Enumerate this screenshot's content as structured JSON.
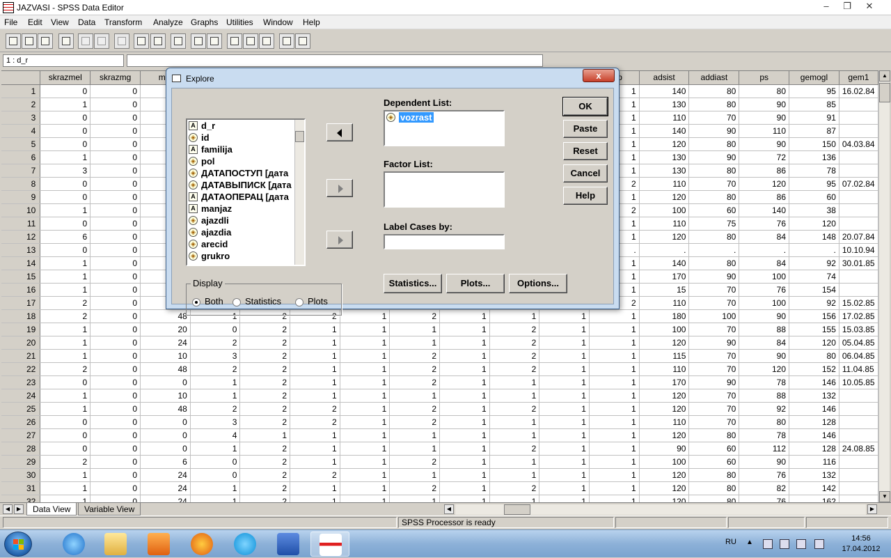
{
  "window": {
    "title": "JAZVASI - SPSS Data Editor"
  },
  "menu": [
    "File",
    "Edit",
    "View",
    "Data",
    "Transform",
    "Analyze",
    "Graphs",
    "Utilities",
    "Window",
    "Help"
  ],
  "cellbar": {
    "ref": "1 : d_r",
    "value": ""
  },
  "grid": {
    "columns": [
      "skrazmel",
      "skrazmg",
      "mel",
      "",
      "",
      "",
      "",
      "",
      "",
      "",
      "",
      "emp",
      "adsist",
      "addiast",
      "ps",
      "gemogl",
      "gem1"
    ],
    "rows": [
      [
        "1",
        "0",
        "0",
        "",
        "",
        "",
        "",
        "",
        "",
        "",
        "",
        "",
        "1",
        "140",
        "80",
        "80",
        "95",
        "16.02.84"
      ],
      [
        "2",
        "1",
        "0",
        "",
        "",
        "",
        "",
        "",
        "",
        "",
        "",
        "",
        "1",
        "130",
        "80",
        "90",
        "85",
        ""
      ],
      [
        "3",
        "0",
        "0",
        "",
        "",
        "",
        "",
        "",
        "",
        "",
        "",
        "",
        "1",
        "110",
        "70",
        "90",
        "91",
        ""
      ],
      [
        "4",
        "0",
        "0",
        "",
        "",
        "",
        "",
        "",
        "",
        "",
        "",
        "",
        "1",
        "140",
        "90",
        "110",
        "87",
        ""
      ],
      [
        "5",
        "0",
        "0",
        "",
        "",
        "",
        "",
        "",
        "",
        "",
        "",
        "",
        "1",
        "120",
        "80",
        "90",
        "150",
        "04.03.84"
      ],
      [
        "6",
        "1",
        "0",
        "",
        "",
        "",
        "",
        "",
        "",
        "",
        "",
        "",
        "1",
        "130",
        "90",
        "72",
        "136",
        ""
      ],
      [
        "7",
        "3",
        "0",
        "",
        "",
        "",
        "",
        "",
        "",
        "",
        "",
        "",
        "1",
        "130",
        "80",
        "86",
        "78",
        ""
      ],
      [
        "8",
        "0",
        "0",
        "",
        "",
        "",
        "",
        "",
        "",
        "",
        "",
        "",
        "2",
        "110",
        "70",
        "120",
        "95",
        "07.02.84"
      ],
      [
        "9",
        "0",
        "0",
        "",
        "",
        "",
        "",
        "",
        "",
        "",
        "",
        "",
        "1",
        "120",
        "80",
        "86",
        "60",
        ""
      ],
      [
        "10",
        "1",
        "0",
        "",
        "",
        "",
        "",
        "",
        "",
        "",
        "",
        "",
        "2",
        "100",
        "60",
        "140",
        "38",
        ""
      ],
      [
        "11",
        "0",
        "0",
        "",
        "",
        "",
        "",
        "",
        "",
        "",
        "",
        "",
        "1",
        "110",
        "75",
        "76",
        "120",
        ""
      ],
      [
        "12",
        "6",
        "0",
        "",
        "",
        "",
        "",
        "",
        "",
        "",
        "",
        "",
        "1",
        "120",
        "80",
        "84",
        "148",
        "20.07.84"
      ],
      [
        "13",
        "0",
        "0",
        "",
        "",
        "",
        "",
        "",
        "",
        "",
        "",
        "",
        ".",
        ".",
        ".",
        ".",
        ".",
        "10.10.94"
      ],
      [
        "14",
        "1",
        "0",
        "",
        "",
        "",
        "",
        "",
        "",
        "",
        "",
        "",
        "1",
        "140",
        "80",
        "84",
        "92",
        "30.01.85"
      ],
      [
        "15",
        "1",
        "0",
        "",
        "",
        "",
        "",
        "",
        "",
        "",
        "",
        "",
        "1",
        "170",
        "90",
        "100",
        "74",
        ""
      ],
      [
        "16",
        "1",
        "0",
        "",
        "",
        "",
        "",
        "",
        "",
        "",
        "",
        "",
        "1",
        "15",
        "70",
        "76",
        "154",
        ""
      ],
      [
        "17",
        "2",
        "0",
        "",
        "",
        "",
        "",
        "",
        "",
        "",
        "",
        "",
        "2",
        "110",
        "70",
        "100",
        "92",
        "15.02.85"
      ],
      [
        "18",
        "2",
        "0",
        "48",
        "1",
        "2",
        "2",
        "1",
        "2",
        "1",
        "1",
        "1",
        "1",
        "180",
        "100",
        "90",
        "156",
        "17.02.85"
      ],
      [
        "19",
        "1",
        "0",
        "20",
        "0",
        "2",
        "1",
        "1",
        "1",
        "1",
        "2",
        "1",
        "1",
        "100",
        "70",
        "88",
        "155",
        "15.03.85"
      ],
      [
        "20",
        "1",
        "0",
        "24",
        "2",
        "2",
        "1",
        "1",
        "1",
        "1",
        "2",
        "1",
        "1",
        "120",
        "90",
        "84",
        "120",
        "05.04.85"
      ],
      [
        "21",
        "1",
        "0",
        "10",
        "3",
        "2",
        "1",
        "1",
        "2",
        "1",
        "2",
        "1",
        "1",
        "115",
        "70",
        "90",
        "80",
        "06.04.85"
      ],
      [
        "22",
        "2",
        "0",
        "48",
        "2",
        "2",
        "1",
        "1",
        "2",
        "1",
        "2",
        "1",
        "1",
        "110",
        "70",
        "120",
        "152",
        "11.04.85"
      ],
      [
        "23",
        "0",
        "0",
        "0",
        "1",
        "2",
        "1",
        "1",
        "2",
        "1",
        "1",
        "1",
        "1",
        "170",
        "90",
        "78",
        "146",
        "10.05.85"
      ],
      [
        "24",
        "1",
        "0",
        "10",
        "1",
        "2",
        "1",
        "1",
        "1",
        "1",
        "1",
        "1",
        "1",
        "120",
        "70",
        "88",
        "132",
        ""
      ],
      [
        "25",
        "1",
        "0",
        "48",
        "2",
        "2",
        "2",
        "1",
        "2",
        "1",
        "2",
        "1",
        "1",
        "120",
        "70",
        "92",
        "146",
        ""
      ],
      [
        "26",
        "0",
        "0",
        "0",
        "3",
        "2",
        "2",
        "1",
        "2",
        "1",
        "1",
        "1",
        "1",
        "110",
        "70",
        "80",
        "128",
        ""
      ],
      [
        "27",
        "0",
        "0",
        "0",
        "4",
        "1",
        "1",
        "1",
        "1",
        "1",
        "1",
        "1",
        "1",
        "120",
        "80",
        "78",
        "146",
        ""
      ],
      [
        "28",
        "0",
        "0",
        "0",
        "1",
        "2",
        "1",
        "1",
        "1",
        "1",
        "2",
        "1",
        "1",
        "90",
        "60",
        "112",
        "128",
        "24.08.85"
      ],
      [
        "29",
        "2",
        "0",
        "6",
        "0",
        "2",
        "1",
        "1",
        "2",
        "1",
        "1",
        "1",
        "1",
        "100",
        "60",
        "90",
        "116",
        ""
      ],
      [
        "30",
        "1",
        "0",
        "24",
        "0",
        "2",
        "2",
        "1",
        "1",
        "1",
        "1",
        "1",
        "1",
        "120",
        "80",
        "76",
        "132",
        ""
      ],
      [
        "31",
        "1",
        "0",
        "24",
        "1",
        "2",
        "1",
        "1",
        "2",
        "1",
        "2",
        "1",
        "1",
        "120",
        "80",
        "82",
        "142",
        ""
      ],
      [
        "32",
        "1",
        "0",
        "24",
        "1",
        "2",
        "1",
        "1",
        "1",
        "1",
        "1",
        "1",
        "1",
        "120",
        "80",
        "76",
        "162",
        ""
      ]
    ]
  },
  "tabs": {
    "data_view": "Data View",
    "variable_view": "Variable View"
  },
  "status": {
    "processor": "SPSS Processor  is ready"
  },
  "dialog": {
    "title": "Explore",
    "variables": [
      {
        "name": "d_r",
        "type": "string"
      },
      {
        "name": "id",
        "type": "numeric"
      },
      {
        "name": "familija",
        "type": "string"
      },
      {
        "name": "pol",
        "type": "numeric"
      },
      {
        "name": "ДАТАПОСТУП [дата",
        "type": "numeric"
      },
      {
        "name": "ДАТАВЫПИСК [дата",
        "type": "numeric"
      },
      {
        "name": "ДАТАОПЕРАЦ [дата",
        "type": "string"
      },
      {
        "name": "manjaz",
        "type": "string"
      },
      {
        "name": "ajazdli",
        "type": "numeric"
      },
      {
        "name": "ajazdia",
        "type": "numeric"
      },
      {
        "name": "arecid",
        "type": "numeric"
      },
      {
        "name": "grukro",
        "type": "numeric"
      }
    ],
    "dependent_label": "Dependent List:",
    "dependent_items": [
      "vozrast"
    ],
    "factor_label": "Factor List:",
    "label_cases_label": "Label Cases by:",
    "display": {
      "legend": "Display",
      "options": [
        "Both",
        "Statistics",
        "Plots"
      ],
      "selected": "Both"
    },
    "buttons": {
      "ok": "OK",
      "paste": "Paste",
      "reset": "Reset",
      "cancel": "Cancel",
      "help": "Help",
      "statistics": "Statistics...",
      "plots": "Plots...",
      "options": "Options..."
    },
    "close_glyph": "x"
  },
  "taskbar": {
    "lang": "RU",
    "time": "14:56",
    "date": "17.04.2012"
  },
  "colors": {
    "selection": "#3399ff",
    "dialog_frame": "#c9dcf0",
    "close_red": "#c8402a"
  }
}
